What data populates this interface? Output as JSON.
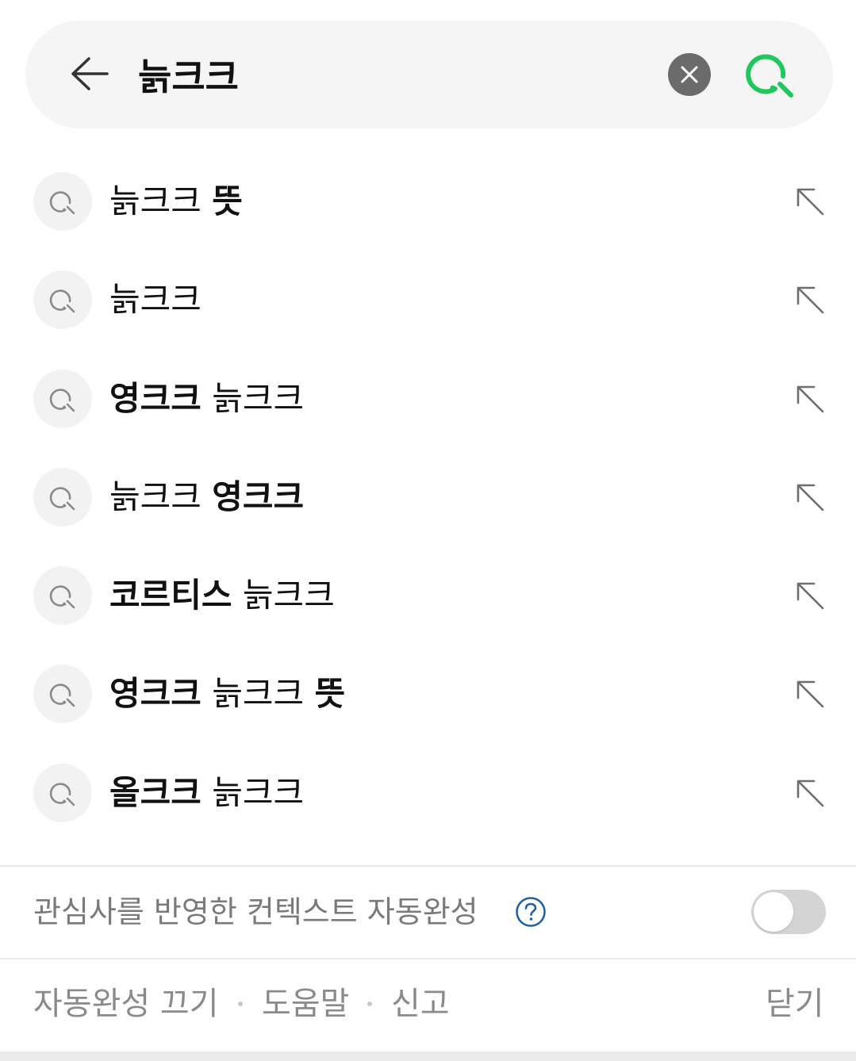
{
  "search": {
    "query": "늙크크"
  },
  "suggestions": [
    {
      "parts": [
        {
          "text": "늙크크 ",
          "bold": false
        },
        {
          "text": "뜻",
          "bold": true
        }
      ]
    },
    {
      "parts": [
        {
          "text": "늙크크",
          "bold": false
        }
      ]
    },
    {
      "parts": [
        {
          "text": "영크크",
          "bold": true
        },
        {
          "text": " 늙크크",
          "bold": false
        }
      ]
    },
    {
      "parts": [
        {
          "text": "늙크크 ",
          "bold": false
        },
        {
          "text": "영크크",
          "bold": true
        }
      ]
    },
    {
      "parts": [
        {
          "text": "코르티스",
          "bold": true
        },
        {
          "text": " 늙크크",
          "bold": false
        }
      ]
    },
    {
      "parts": [
        {
          "text": "영크크",
          "bold": true
        },
        {
          "text": " 늙크크 ",
          "bold": false
        },
        {
          "text": "뜻",
          "bold": true
        }
      ]
    },
    {
      "parts": [
        {
          "text": "올크크",
          "bold": true
        },
        {
          "text": " 늙크크",
          "bold": false
        }
      ]
    }
  ],
  "context_autocomplete": {
    "label": "관심사를 반영한 컨텍스트 자동완성",
    "enabled": false
  },
  "footer": {
    "autocomplete_off": "자동완성 끄기",
    "help": "도움말",
    "report": "신고",
    "close": "닫기"
  },
  "colors": {
    "accent_green": "#1ec85c",
    "help_blue": "#1f5fa8"
  }
}
